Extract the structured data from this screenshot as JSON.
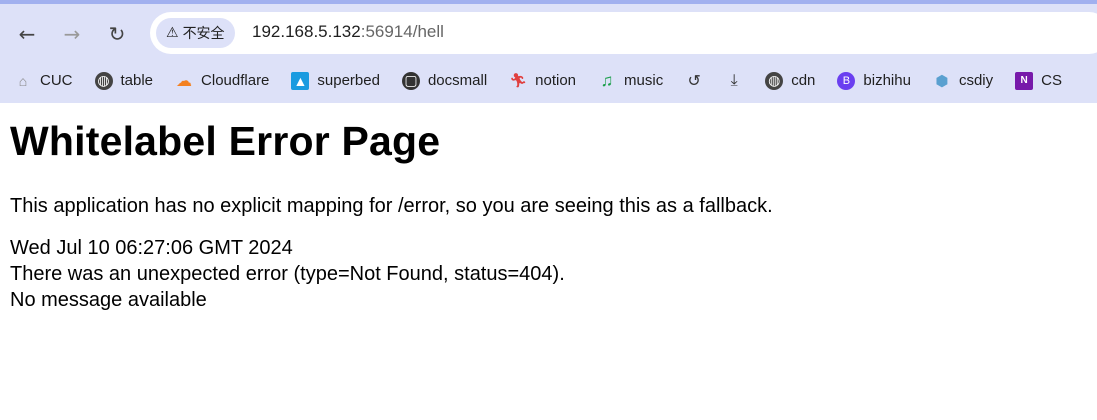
{
  "browser": {
    "security_chip": "不安全",
    "url_host": "192.168.5.132",
    "url_rest": ":56914/hell",
    "colors": {
      "toolbar": "#dde1f8",
      "accent_stripe": "#a1b0ef"
    }
  },
  "bookmarks": [
    {
      "label": "CUC",
      "icon": "home-icon"
    },
    {
      "label": "table",
      "icon": "globe-icon"
    },
    {
      "label": "Cloudflare",
      "icon": "cloudflare-icon"
    },
    {
      "label": "superbed",
      "icon": "image-icon"
    },
    {
      "label": "docsmall",
      "icon": "docsmall-icon"
    },
    {
      "label": "notion",
      "icon": "runner-icon"
    },
    {
      "label": "music",
      "icon": "music-note-icon"
    },
    {
      "label": "",
      "icon": "history-icon"
    },
    {
      "label": "",
      "icon": "download-icon"
    },
    {
      "label": "cdn",
      "icon": "globe-icon"
    },
    {
      "label": "bizhihu",
      "icon": "bizhihu-icon"
    },
    {
      "label": "csdiy",
      "icon": "cube-icon"
    },
    {
      "label": "CS",
      "icon": "onenote-icon"
    }
  ],
  "page": {
    "title": "Whitelabel Error Page",
    "description": "This application has no explicit mapping for /error, so you are seeing this as a fallback.",
    "timestamp": "Wed Jul 10 06:27:06 GMT 2024",
    "error": "There was an unexpected error (type=Not Found, status=404).",
    "message": "No message available"
  }
}
